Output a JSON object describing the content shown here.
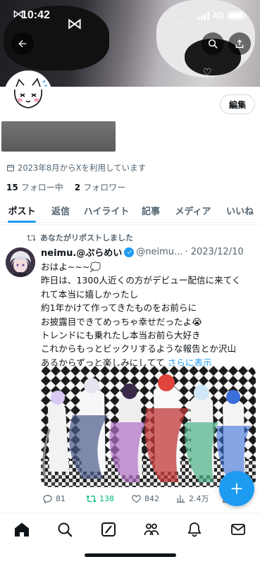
{
  "status_bar": {
    "time": "10:42",
    "network": "4G"
  },
  "profile": {
    "edit_label": "編集",
    "joined": "2023年8月からXを利用しています",
    "following_count": "15",
    "following_label": "フォロー中",
    "followers_count": "2",
    "followers_label": "フォロワー"
  },
  "tabs": [
    {
      "label": "ポスト",
      "active": true
    },
    {
      "label": "返信"
    },
    {
      "label": "ハイライト"
    },
    {
      "label": "記事"
    },
    {
      "label": "メディア"
    },
    {
      "label": "いいね"
    }
  ],
  "tweet": {
    "repost_label": "あなたがリポストしました",
    "name": "neimu.@ぷらめい",
    "handle": "@neimu...",
    "date": "· 2023/12/10",
    "lines": [
      "おはよ~~~💭",
      "昨日は、1300人近くの方がデビュー配信に来てく",
      "れて本当に嬉しかったし",
      "約1年かけて作ってきたものをお前らに",
      "お披露目できてめっちゃ幸せだったよ😭",
      "トレンドにも乗れたし本当お前ら大好き",
      "これからもっとビックリするような報告とか沢山",
      "あるからずっと楽しみにしてて"
    ],
    "more_label": "さらに表示",
    "replies": "81",
    "reposts": "138",
    "likes": "842",
    "views": "2.4万"
  },
  "icons": {
    "back": "arrow-left-icon",
    "search": "search-icon",
    "share": "share-icon",
    "calendar": "calendar-icon",
    "repost": "repost-icon",
    "compose": "plus-icon"
  },
  "colors": {
    "accent": "#1d9bf0",
    "repost_green": "#00ba7c",
    "muted": "#536471"
  }
}
